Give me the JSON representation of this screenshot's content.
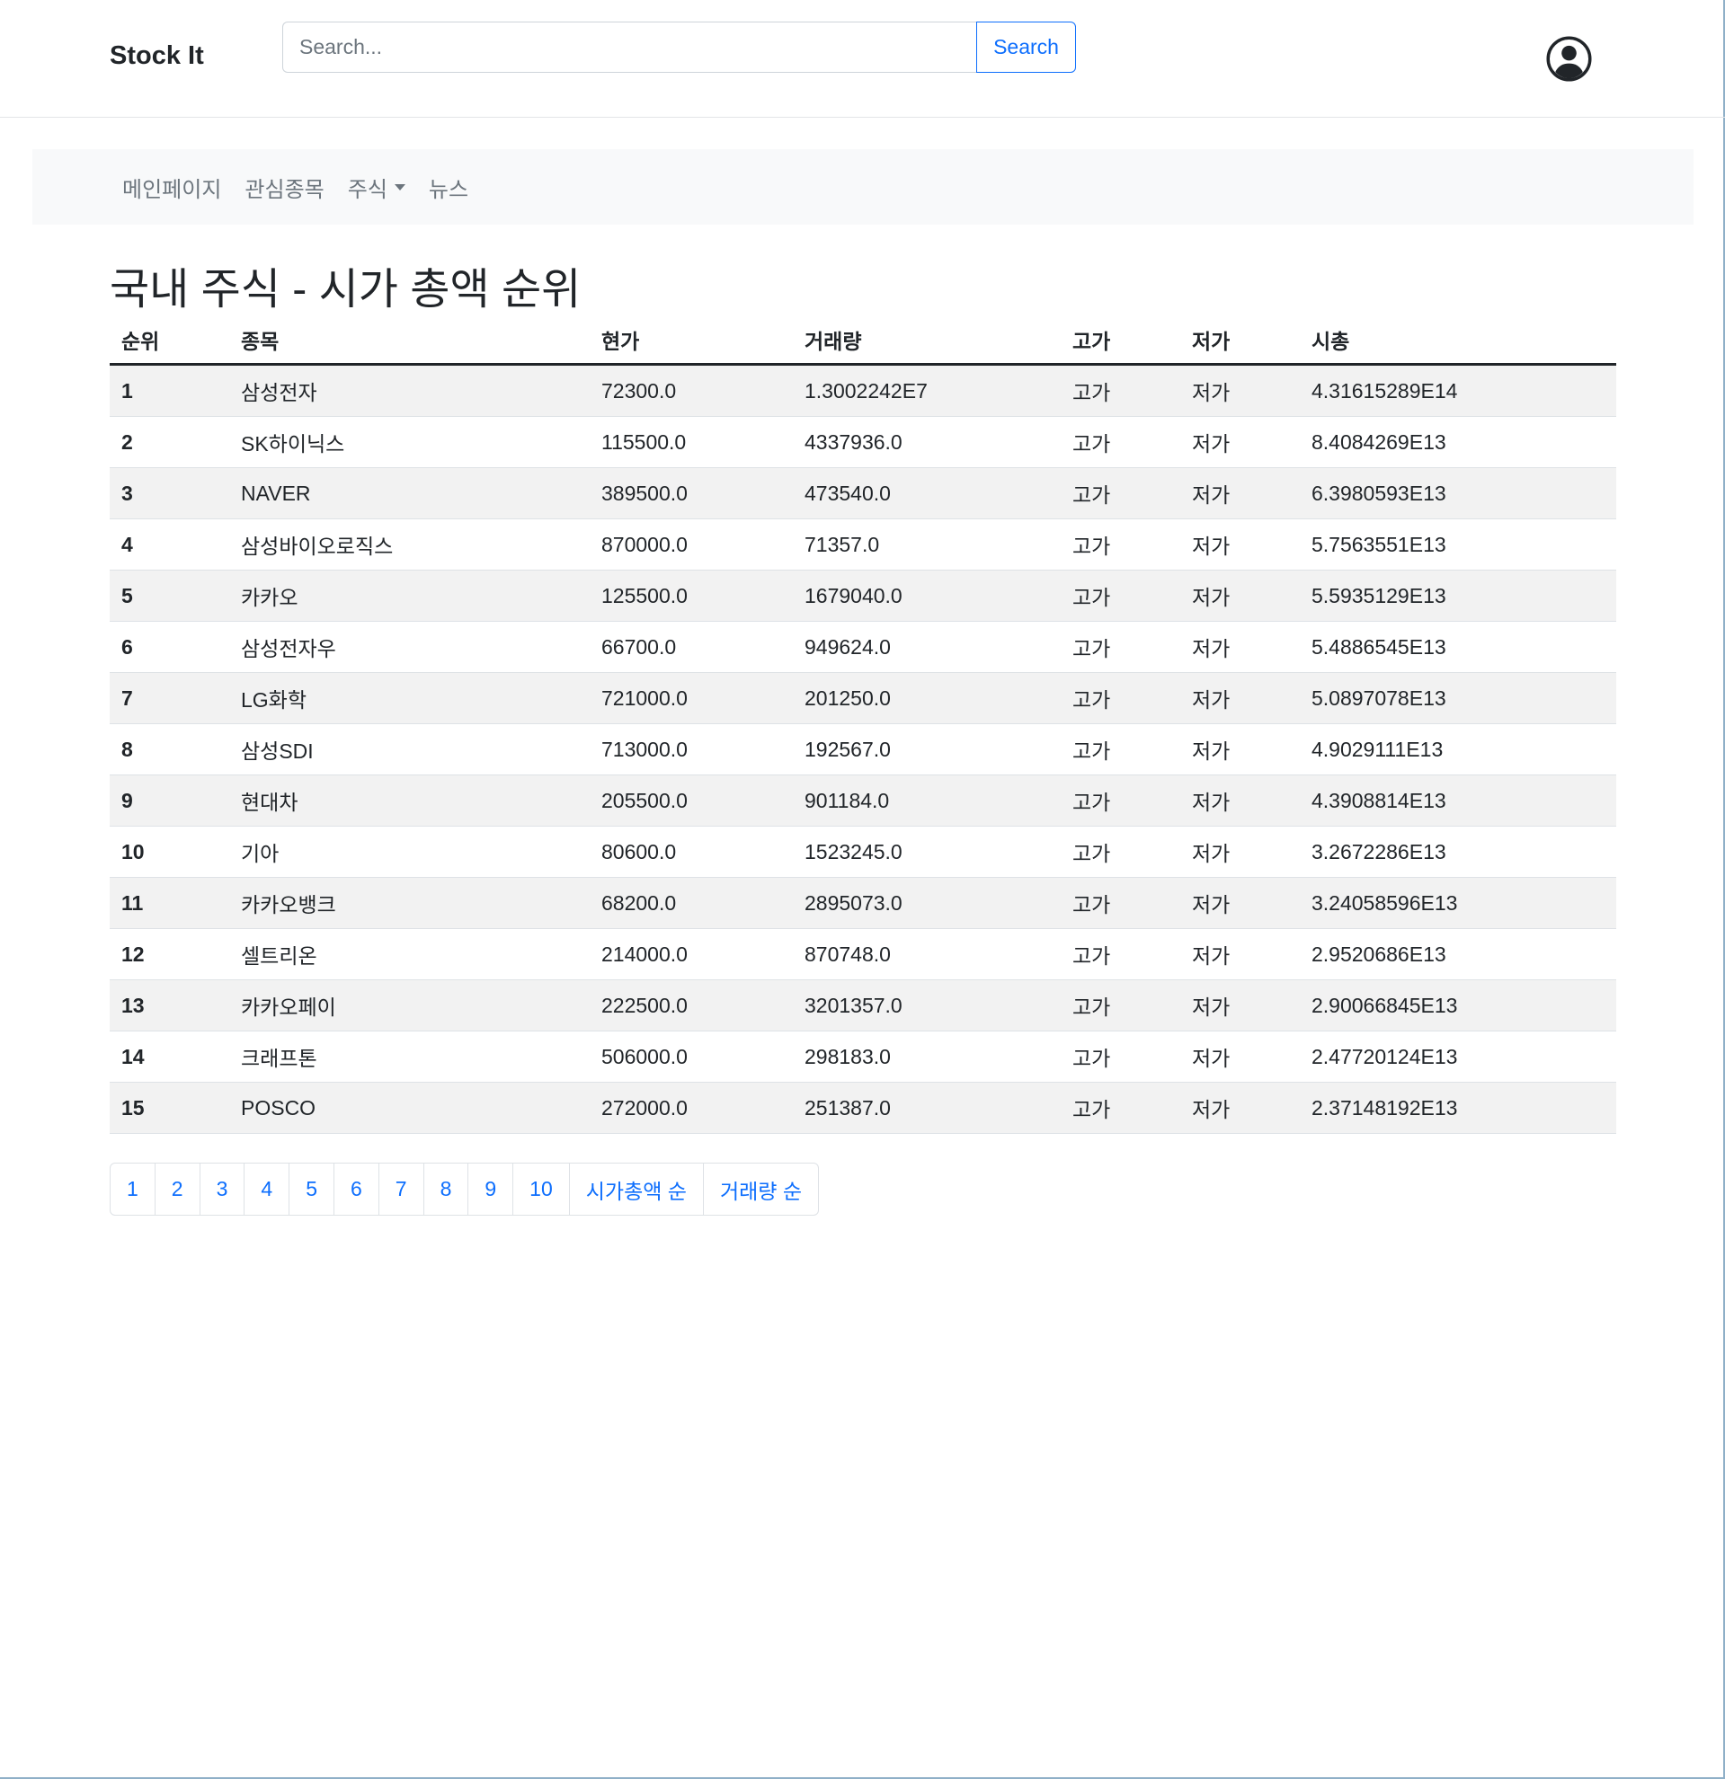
{
  "brand": "Stock It",
  "search": {
    "placeholder": "Search...",
    "value": "",
    "button_label": "Search"
  },
  "nav": {
    "items": [
      "메인페이지",
      "관심종목",
      "주식",
      "뉴스"
    ]
  },
  "page_title": "국내 주식 - 시가 총액 순위",
  "table": {
    "headers": [
      "순위",
      "종목",
      "현가",
      "거래량",
      "고가",
      "저가",
      "시총"
    ],
    "rows": [
      {
        "rank": "1",
        "name": "삼성전자",
        "price": "72300.0",
        "volume": "1.3002242E7",
        "high": "고가",
        "low": "저가",
        "cap": "4.31615289E14"
      },
      {
        "rank": "2",
        "name": "SK하이닉스",
        "price": "115500.0",
        "volume": "4337936.0",
        "high": "고가",
        "low": "저가",
        "cap": "8.4084269E13"
      },
      {
        "rank": "3",
        "name": "NAVER",
        "price": "389500.0",
        "volume": "473540.0",
        "high": "고가",
        "low": "저가",
        "cap": "6.3980593E13"
      },
      {
        "rank": "4",
        "name": "삼성바이오로직스",
        "price": "870000.0",
        "volume": "71357.0",
        "high": "고가",
        "low": "저가",
        "cap": "5.7563551E13"
      },
      {
        "rank": "5",
        "name": "카카오",
        "price": "125500.0",
        "volume": "1679040.0",
        "high": "고가",
        "low": "저가",
        "cap": "5.5935129E13"
      },
      {
        "rank": "6",
        "name": "삼성전자우",
        "price": "66700.0",
        "volume": "949624.0",
        "high": "고가",
        "low": "저가",
        "cap": "5.4886545E13"
      },
      {
        "rank": "7",
        "name": "LG화학",
        "price": "721000.0",
        "volume": "201250.0",
        "high": "고가",
        "low": "저가",
        "cap": "5.0897078E13"
      },
      {
        "rank": "8",
        "name": "삼성SDI",
        "price": "713000.0",
        "volume": "192567.0",
        "high": "고가",
        "low": "저가",
        "cap": "4.9029111E13"
      },
      {
        "rank": "9",
        "name": "현대차",
        "price": "205500.0",
        "volume": "901184.0",
        "high": "고가",
        "low": "저가",
        "cap": "4.3908814E13"
      },
      {
        "rank": "10",
        "name": "기아",
        "price": "80600.0",
        "volume": "1523245.0",
        "high": "고가",
        "low": "저가",
        "cap": "3.2672286E13"
      },
      {
        "rank": "11",
        "name": "카카오뱅크",
        "price": "68200.0",
        "volume": "2895073.0",
        "high": "고가",
        "low": "저가",
        "cap": "3.24058596E13"
      },
      {
        "rank": "12",
        "name": "셀트리온",
        "price": "214000.0",
        "volume": "870748.0",
        "high": "고가",
        "low": "저가",
        "cap": "2.9520686E13"
      },
      {
        "rank": "13",
        "name": "카카오페이",
        "price": "222500.0",
        "volume": "3201357.0",
        "high": "고가",
        "low": "저가",
        "cap": "2.90066845E13"
      },
      {
        "rank": "14",
        "name": "크래프톤",
        "price": "506000.0",
        "volume": "298183.0",
        "high": "고가",
        "low": "저가",
        "cap": "2.47720124E13"
      },
      {
        "rank": "15",
        "name": "POSCO",
        "price": "272000.0",
        "volume": "251387.0",
        "high": "고가",
        "low": "저가",
        "cap": "2.37148192E13"
      }
    ]
  },
  "pagination": {
    "pages": [
      "1",
      "2",
      "3",
      "4",
      "5",
      "6",
      "7",
      "8",
      "9",
      "10"
    ],
    "sort_links": [
      "시가총액 순",
      "거래량 순"
    ]
  },
  "icons": {
    "user": "user-circle-icon",
    "nav_dropdown": "caret-down-icon"
  },
  "colors": {
    "link": "#0d6efd",
    "nav_text": "#6c757d",
    "navbar_bg": "#f8f9fa",
    "stripe": "#f2f2f2"
  }
}
